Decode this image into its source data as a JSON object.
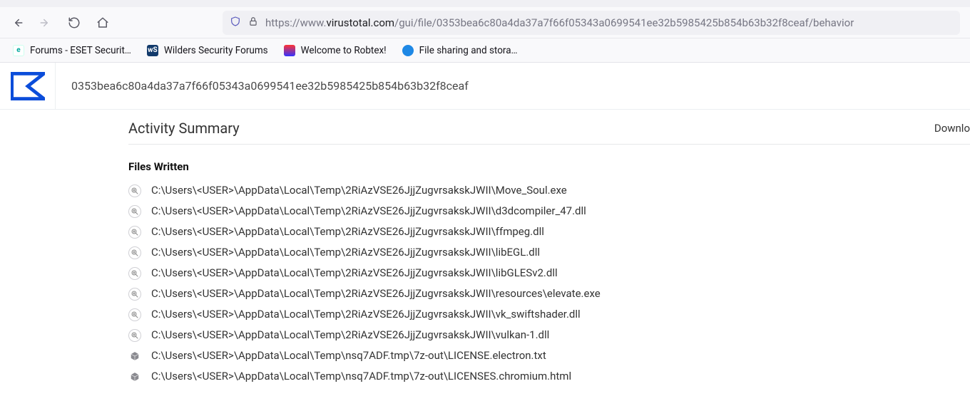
{
  "url": {
    "prefix": "https://www.",
    "host": "virustotal.com",
    "path": "/gui/file/0353bea6c80a4da37a7f66f05343a0699541ee32b5985425b854b63b32f8ceaf/behavior"
  },
  "bookmarks": [
    {
      "label": "Forums - ESET Securit…",
      "icon": "eset"
    },
    {
      "label": "Wilders Security Forums",
      "icon": "ws"
    },
    {
      "label": "Welcome to Robtex!",
      "icon": "robtex"
    },
    {
      "label": "File sharing and stora…",
      "icon": "cloud"
    }
  ],
  "page": {
    "hash": "0353bea6c80a4da37a7f66f05343a0699541ee32b5985425b854b63b32f8ceaf",
    "section_title": "Activity Summary",
    "download_label": "Downlo",
    "files_written_label": "Files Written",
    "files_written": [
      {
        "icon": "mag",
        "path": "C:\\Users\\<USER>\\AppData\\Local\\Temp\\2RiAzVSE26JjjZugvrsakskJWII\\Move_Soul.exe"
      },
      {
        "icon": "mag",
        "path": "C:\\Users\\<USER>\\AppData\\Local\\Temp\\2RiAzVSE26JjjZugvrsakskJWII\\d3dcompiler_47.dll"
      },
      {
        "icon": "mag",
        "path": "C:\\Users\\<USER>\\AppData\\Local\\Temp\\2RiAzVSE26JjjZugvrsakskJWII\\ffmpeg.dll"
      },
      {
        "icon": "mag",
        "path": "C:\\Users\\<USER>\\AppData\\Local\\Temp\\2RiAzVSE26JjjZugvrsakskJWII\\libEGL.dll"
      },
      {
        "icon": "mag",
        "path": "C:\\Users\\<USER>\\AppData\\Local\\Temp\\2RiAzVSE26JjjZugvrsakskJWII\\libGLESv2.dll"
      },
      {
        "icon": "mag",
        "path": "C:\\Users\\<USER>\\AppData\\Local\\Temp\\2RiAzVSE26JjjZugvrsakskJWII\\resources\\elevate.exe"
      },
      {
        "icon": "mag",
        "path": "C:\\Users\\<USER>\\AppData\\Local\\Temp\\2RiAzVSE26JjjZugvrsakskJWII\\vk_swiftshader.dll"
      },
      {
        "icon": "mag",
        "path": "C:\\Users\\<USER>\\AppData\\Local\\Temp\\2RiAzVSE26JjjZugvrsakskJWII\\vulkan-1.dll"
      },
      {
        "icon": "box",
        "path": "C:\\Users\\<USER>\\AppData\\Local\\Temp\\nsq7ADF.tmp\\7z-out\\LICENSE.electron.txt"
      },
      {
        "icon": "box",
        "path": "C:\\Users\\<USER>\\AppData\\Local\\Temp\\nsq7ADF.tmp\\7z-out\\LICENSES.chromium.html"
      }
    ]
  }
}
